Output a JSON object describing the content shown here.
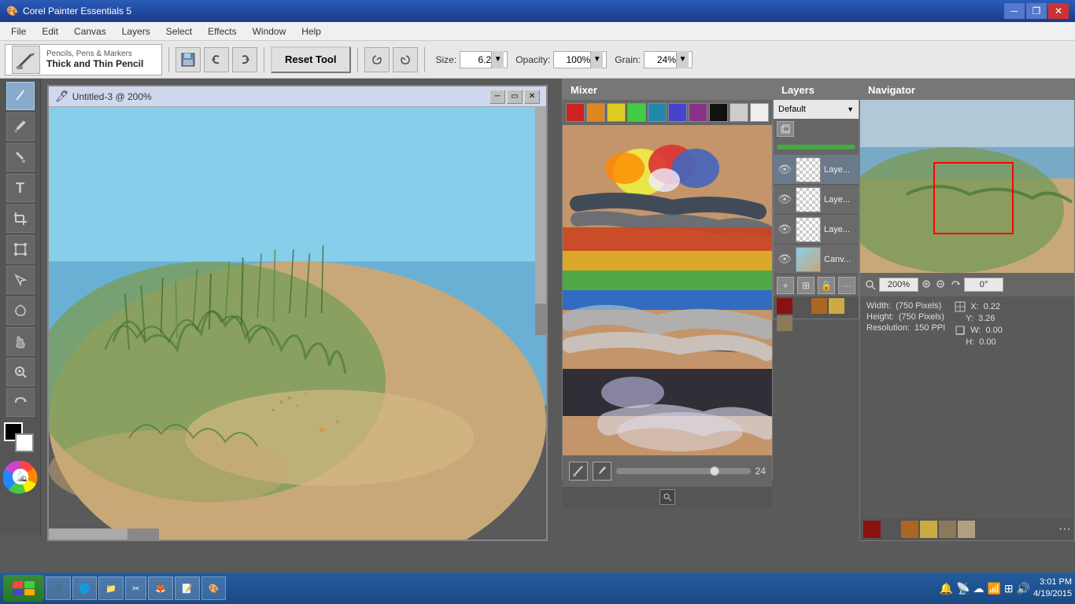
{
  "app": {
    "title": "Corel Painter Essentials 5",
    "icon": "🎨"
  },
  "title_bar": {
    "minimize": "─",
    "restore": "❐",
    "close": "✕"
  },
  "menu": {
    "items": [
      "File",
      "Edit",
      "Canvas",
      "Layers",
      "Select",
      "Effects",
      "Window",
      "Help"
    ]
  },
  "toolbar": {
    "brush_category": "Pencils, Pens & Markers",
    "brush_name": "Thick and Thin Pencil",
    "reset_tool": "Reset Tool",
    "size_label": "Size:",
    "size_value": "6.2",
    "opacity_label": "Opacity:",
    "opacity_value": "100%",
    "grain_label": "Grain:",
    "grain_value": "24%"
  },
  "canvas_window": {
    "title": "Untitled-3 @ 200%",
    "icon": "🖊"
  },
  "mixer": {
    "title": "Mixer",
    "colors": [
      "#cc2222",
      "#dd8822",
      "#ddcc22",
      "#44cc44",
      "#2288aa",
      "#4444cc",
      "#883388",
      "#111111",
      "#cccccc",
      "#eeeeee"
    ],
    "brush_size": "24"
  },
  "layers": {
    "title": "Layers",
    "preset": "Default",
    "items": [
      {
        "name": "Laye...",
        "visible": true,
        "active": false
      },
      {
        "name": "Laye...",
        "visible": true,
        "active": false
      },
      {
        "name": "Laye...",
        "visible": true,
        "active": false
      },
      {
        "name": "Canv...",
        "visible": true,
        "active": false
      }
    ]
  },
  "navigator": {
    "title": "Navigator",
    "zoom": "200%",
    "rotation": "0°",
    "width_label": "Width:",
    "width_value": "(750 Pixels)",
    "height_label": "Height:",
    "height_value": "(750 Pixels)",
    "resolution_label": "Resolution:",
    "resolution_value": "150 PPI",
    "x_label": "X:",
    "x_value": "0.22",
    "y_label": "Y:",
    "y_value": "3.26",
    "w_label": "W:",
    "w_value": "0.00",
    "h_label": "H:",
    "h_value": "0.00"
  },
  "taskbar": {
    "start": "start",
    "apps": [
      "🎵",
      "🌐",
      "📁",
      "✂",
      "🦊",
      "📝",
      "🎨"
    ],
    "time": "3:01 PM",
    "date": "4/19/2015"
  },
  "color_swatches": [
    "#881111",
    "#555555",
    "#aa6622",
    "#ccaa44",
    "#8a7a5a",
    "#b0a080"
  ]
}
